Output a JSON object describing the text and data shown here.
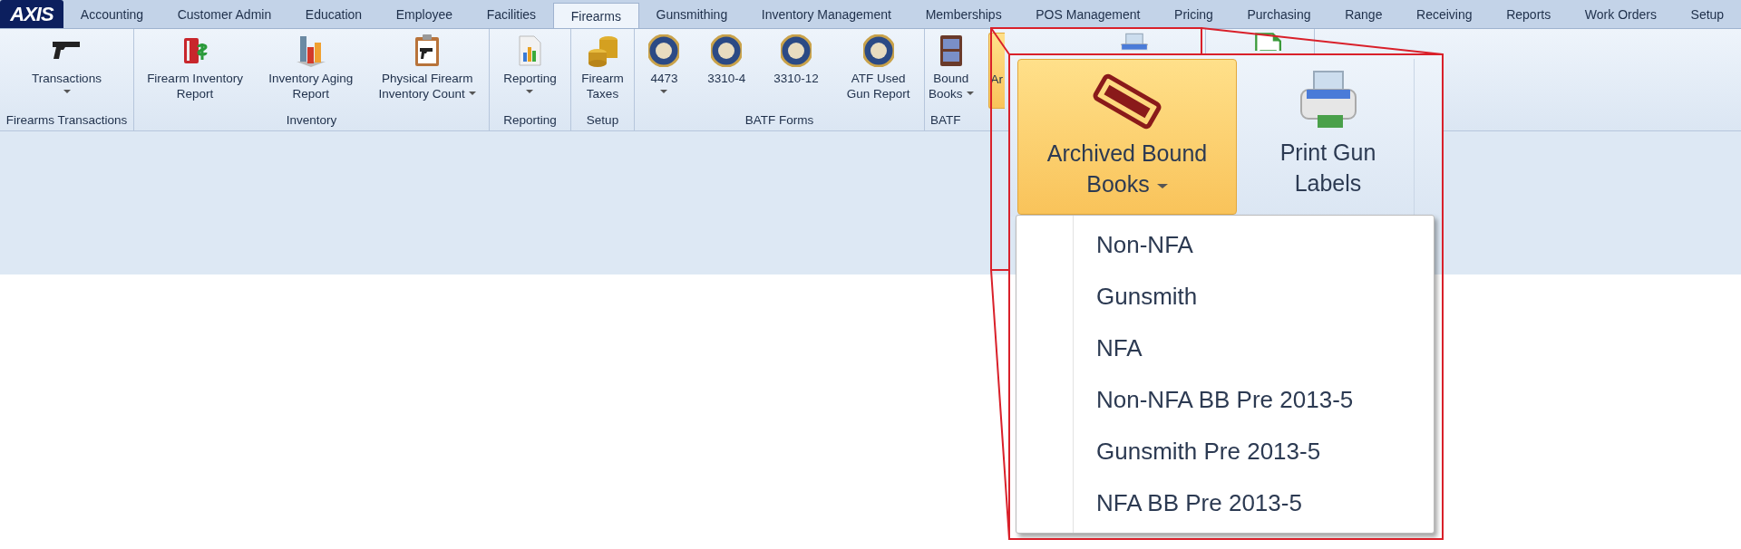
{
  "logo": "AXIS",
  "tabs": [
    {
      "label": "Accounting",
      "selected": false
    },
    {
      "label": "Customer Admin",
      "selected": false
    },
    {
      "label": "Education",
      "selected": false
    },
    {
      "label": "Employee",
      "selected": false
    },
    {
      "label": "Facilities",
      "selected": false
    },
    {
      "label": "Firearms",
      "selected": true
    },
    {
      "label": "Gunsmithing",
      "selected": false
    },
    {
      "label": "Inventory Management",
      "selected": false
    },
    {
      "label": "Memberships",
      "selected": false
    },
    {
      "label": "POS Management",
      "selected": false
    },
    {
      "label": "Pricing",
      "selected": false
    },
    {
      "label": "Purchasing",
      "selected": false
    },
    {
      "label": "Range",
      "selected": false
    },
    {
      "label": "Receiving",
      "selected": false
    },
    {
      "label": "Reports",
      "selected": false
    },
    {
      "label": "Work Orders",
      "selected": false
    },
    {
      "label": "Setup",
      "selected": false
    }
  ],
  "ribbon": {
    "groups": [
      {
        "label": "Firearms Transactions",
        "buttons": [
          {
            "kind": "pistol",
            "label": "Transactions",
            "dropdown": true,
            "open": false
          }
        ]
      },
      {
        "label": "Inventory",
        "buttons": [
          {
            "kind": "ledger",
            "label": "Firearm Inventory\nReport",
            "dropdown": false,
            "open": false
          },
          {
            "kind": "barchart",
            "label": "Inventory Aging\nReport",
            "dropdown": false,
            "open": false
          },
          {
            "kind": "clipboard",
            "label": "Physical Firearm\nInventory Count",
            "dropdown": true,
            "open": false
          }
        ]
      },
      {
        "label": "Reporting",
        "buttons": [
          {
            "kind": "report",
            "label": "Reporting",
            "dropdown": true,
            "open": false
          }
        ]
      },
      {
        "label": "Setup",
        "buttons": [
          {
            "kind": "coins",
            "label": "Firearm\nTaxes",
            "dropdown": false,
            "open": false
          }
        ]
      },
      {
        "label": "BATF Forms",
        "buttons": [
          {
            "kind": "seal",
            "label": "4473",
            "dropdown": true,
            "open": false
          },
          {
            "kind": "seal",
            "label": "3310-4",
            "dropdown": false,
            "open": false
          },
          {
            "kind": "seal",
            "label": "3310-12",
            "dropdown": false,
            "open": false
          },
          {
            "kind": "seal",
            "label": "ATF Used\nGun Report",
            "dropdown": false,
            "open": false
          }
        ]
      },
      {
        "label": "BATF",
        "buttons": [
          {
            "kind": "atfbook",
            "label": "Bound\nBooks",
            "dropdown": true,
            "open": false
          },
          {
            "label": "Ar",
            "dropdown": false,
            "open": true
          },
          {
            "kind": "printer",
            "open": false
          }
        ]
      },
      {
        "buttons": [
          {
            "kind": "sheet",
            "open": false
          }
        ]
      }
    ]
  },
  "magnifier": {
    "buttons": [
      {
        "kind": "stamp",
        "label": "Archived Bound\nBooks",
        "dropdown": true,
        "open": true
      },
      {
        "kind": "printer",
        "label": "Print Gun\nLabels",
        "dropdown": false,
        "open": false
      }
    ],
    "menu": [
      "Non-NFA",
      "Gunsmith",
      "NFA",
      "Non-NFA BB Pre 2013-5",
      "Gunsmith Pre 2013-5",
      "NFA BB Pre 2013-5"
    ]
  }
}
